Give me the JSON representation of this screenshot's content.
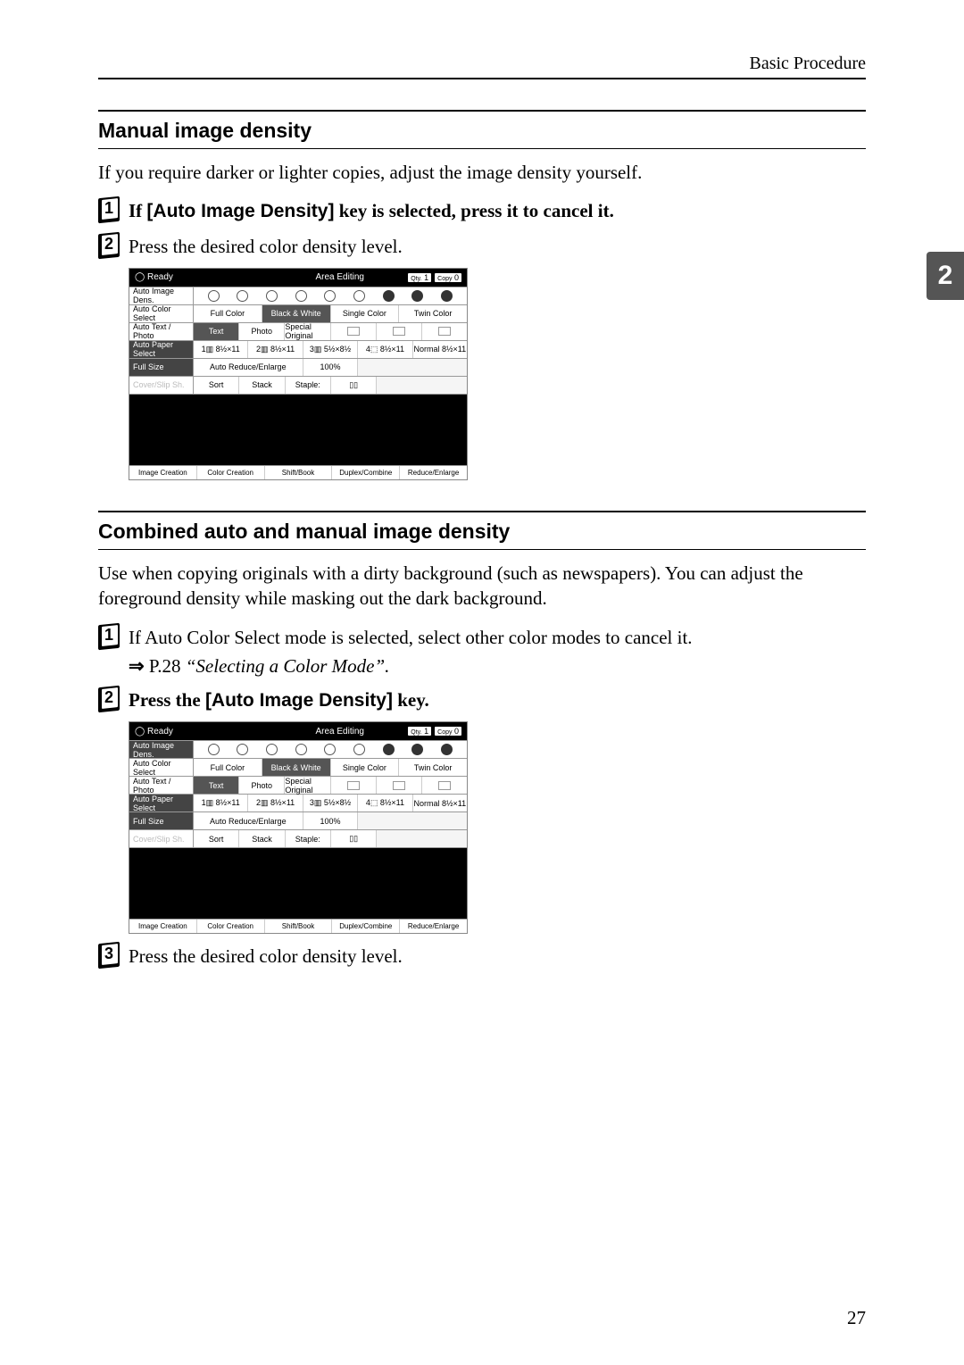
{
  "header": {
    "section": "Basic Procedure"
  },
  "sidetab": "2",
  "sec1": {
    "heading": "Manual image density",
    "intro": "If you require darker or lighter copies, adjust the image density yourself.",
    "step1": {
      "pre": "If ",
      "key": "[Auto Image Density]",
      "post": " key is selected, press it to cancel it."
    },
    "step2": "Press the desired color density level."
  },
  "sec2": {
    "heading": "Combined auto and manual image density",
    "intro": "Use when copying originals with a dirty background (such as newspapers). You can adjust the foreground density while masking out the dark background.",
    "step1": "If Auto Color Select mode is selected, select other color modes to cancel it.",
    "ref": {
      "arrow": "⇒",
      "page": "P.28",
      "title": "“Selecting a Color Mode”."
    },
    "step2": {
      "pre": "Press the ",
      "key": "[Auto Image Density]",
      "post": " key."
    },
    "step3": "Press the desired color density level."
  },
  "panel": {
    "ready": "Ready",
    "area": "Area Editing",
    "qty": "1",
    "copy": "0",
    "rows": {
      "autoImageDens": "Auto Image Dens.",
      "autoColorSelect": "Auto Color Select",
      "fullColor": "Full Color",
      "blackWhite": "Black & White",
      "singleColor": "Single Color",
      "twinColor": "Twin Color",
      "autoTextPhoto": "Auto Text / Photo",
      "text": "Text",
      "photo": "Photo",
      "specialOriginal": "Special Original",
      "autoPaperSelect": "Auto Paper Select",
      "paper1": "8½×11",
      "paper2": "8½×11",
      "paper3": "5½×8½",
      "paper4": "8½×11",
      "paperNormal": "Normal 8½×11",
      "fullSize": "Full Size",
      "autoRE": "Auto Reduce/Enlarge",
      "ratio": "100%",
      "sort": "Sort",
      "stack": "Stack",
      "staple": "Staple:"
    },
    "bottom": {
      "imageCreation": "Image Creation",
      "colorCreation": "Color Creation",
      "shiftBook": "Shift/Book",
      "duplexCombine": "Duplex/Combine",
      "reduceEnlarge": "Reduce/Enlarge"
    }
  },
  "pageNumber": "27"
}
